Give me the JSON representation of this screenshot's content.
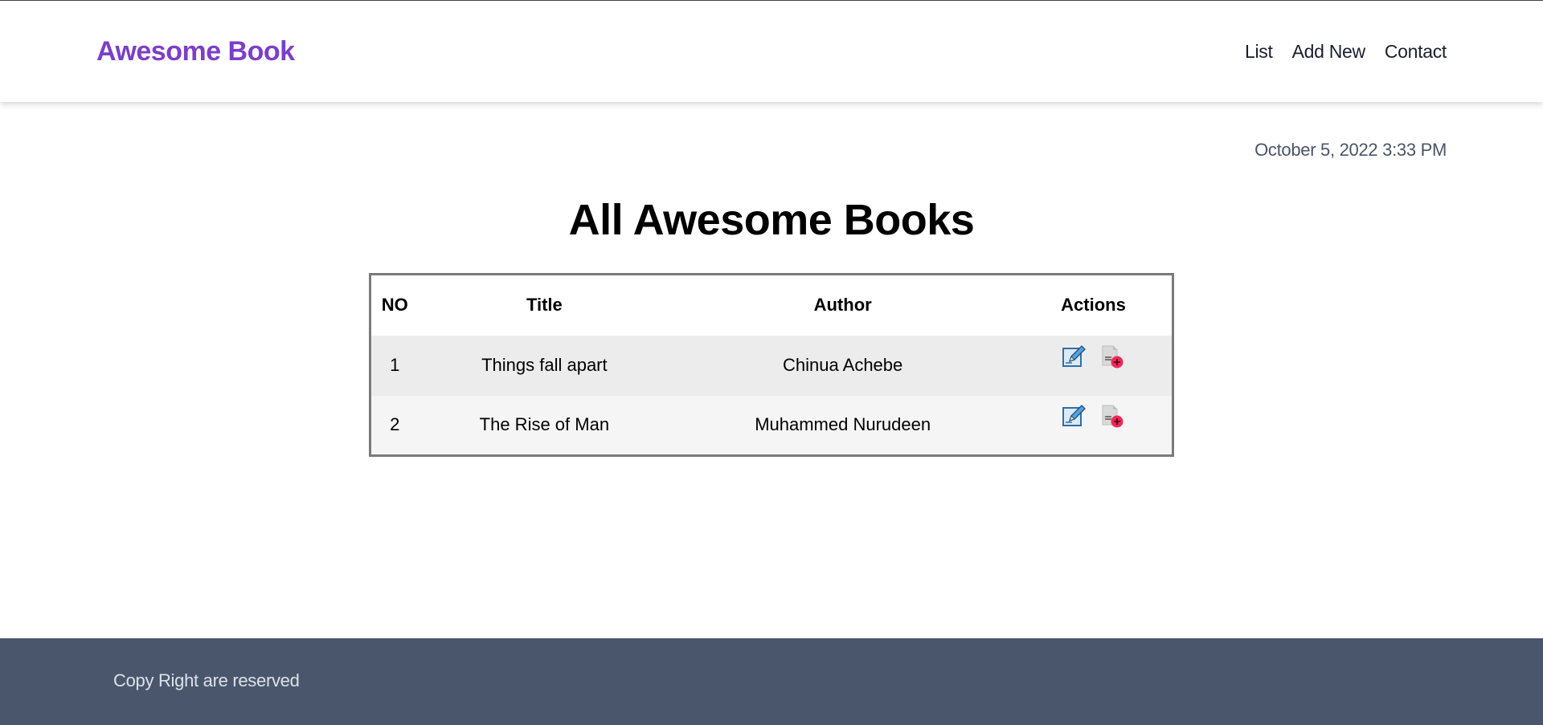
{
  "header": {
    "logo": "Awesome Book",
    "nav": [
      {
        "label": "List"
      },
      {
        "label": "Add New"
      },
      {
        "label": "Contact"
      }
    ]
  },
  "date_display": "October 5, 2022 3:33 PM",
  "main": {
    "title": "All Awesome Books",
    "table": {
      "columns": [
        "NO",
        "Title",
        "Author",
        "Actions"
      ],
      "rows": [
        {
          "no": "1",
          "title": "Things fall apart",
          "author": "Chinua Achebe",
          "actions": [
            "edit-icon",
            "remove-document-icon"
          ]
        },
        {
          "no": "2",
          "title": "The Rise of Man",
          "author": "Muhammed Nurudeen",
          "actions": [
            "edit-icon",
            "remove-document-icon"
          ]
        }
      ]
    }
  },
  "footer": {
    "copyright": "Copy Right are reserved"
  },
  "colors": {
    "brand": "#7c3fc7",
    "footer_bg": "#4a566c",
    "row_odd": "#ececec",
    "row_even": "#f5f5f5",
    "delete_badge": "#f0285a",
    "edit_blue": "#3a87c8"
  }
}
